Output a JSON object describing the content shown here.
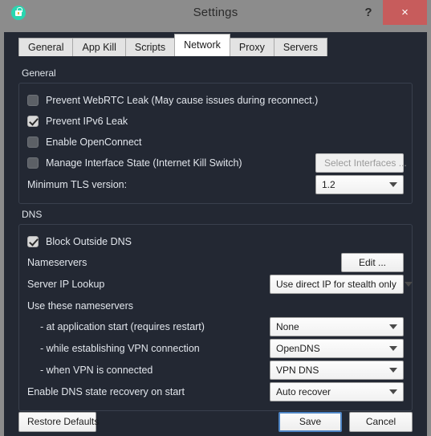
{
  "window": {
    "title": "Settings",
    "app_icon": "padlock-icon",
    "help_label": "?",
    "close_label": "×",
    "accent_close": "#c75c5c",
    "accent_icon": "#2ad6b0",
    "accent_focus": "#4f86c6",
    "bg_content": "#232833",
    "bg_frame": "#8c8c8c"
  },
  "tabs": [
    {
      "label": "General",
      "active": false
    },
    {
      "label": "App Kill",
      "active": false
    },
    {
      "label": "Scripts",
      "active": false
    },
    {
      "label": "Network",
      "active": true
    },
    {
      "label": "Proxy",
      "active": false
    },
    {
      "label": "Servers",
      "active": false
    }
  ],
  "general": {
    "section_label": "General",
    "checkboxes": [
      {
        "label": "Prevent WebRTC Leak (May cause issues during reconnect.)",
        "checked": false
      },
      {
        "label": "Prevent IPv6 Leak",
        "checked": true
      },
      {
        "label": "Enable OpenConnect",
        "checked": false
      },
      {
        "label": "Manage Interface State (Internet Kill Switch)",
        "checked": false
      }
    ],
    "select_interfaces_label": "Select Interfaces ...",
    "select_interfaces_enabled": false,
    "tls_label": "Minimum TLS version:",
    "tls_value": "1.2"
  },
  "dns": {
    "section_label": "DNS",
    "block_outside_dns": {
      "label": "Block Outside DNS",
      "checked": true
    },
    "nameservers_label": "Nameservers",
    "edit_label": "Edit ...",
    "server_ip_lookup_label": "Server IP Lookup",
    "server_ip_lookup_value": "Use direct IP for stealth only",
    "use_these_nameservers_label": "Use these nameservers",
    "rows": [
      {
        "label": "- at application start (requires restart)",
        "value": "None"
      },
      {
        "label": "- while establishing VPN connection",
        "value": "OpenDNS"
      },
      {
        "label": "- when VPN is connected",
        "value": "VPN DNS"
      }
    ],
    "recovery_label": "Enable DNS state recovery on start",
    "recovery_value": "Auto recover"
  },
  "footer": {
    "restore_label": "Restore Defaults",
    "save_label": "Save",
    "cancel_label": "Cancel"
  }
}
